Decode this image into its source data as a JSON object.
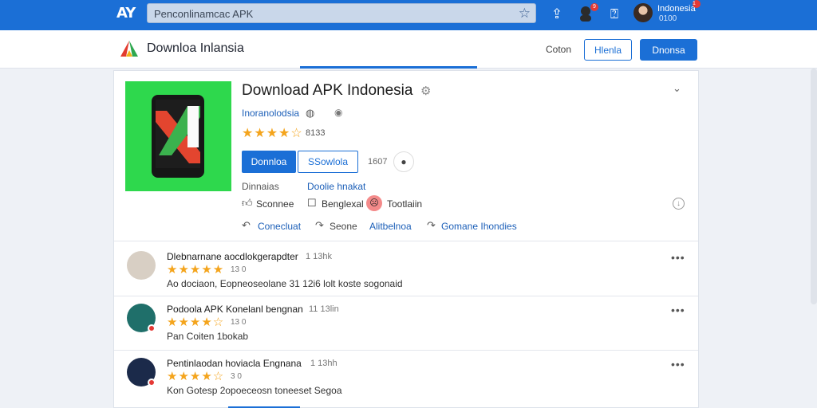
{
  "topbar": {
    "logo": "AY",
    "search_value": "Penconlinamcac APK",
    "notif_count": "9",
    "user_name": "Indonesia",
    "user_sub": "0100",
    "user_badge": "1"
  },
  "nav": {
    "brand": "Downloa Inlansia",
    "link": "Coton",
    "outline_btn": "Hlenla",
    "primary_btn": "Dnonsa"
  },
  "app": {
    "title": "Download APK Indonesia",
    "developer": "Inoranolodsia",
    "rating_stars": "★★★★☆",
    "rating_count": "8133",
    "primary_btn": "Donnloa",
    "secondary_btn": "SSowlola",
    "size": "1607",
    "meta_label": "Dinnaias",
    "meta_link": "Doolie hnakat",
    "items": [
      "Sconnee",
      "Benglexal",
      "Tootlaiin"
    ],
    "actions": [
      "Conecluat",
      "Seone",
      "Alitbelnoa",
      "Gomane Ihondies"
    ]
  },
  "reviews": [
    {
      "title": "Dlebnarnane aocdlokgerapdter",
      "time": "1 13hk",
      "stars": "★★★★★",
      "count": "13 0",
      "text": "Ao dociaon,  Eopneoseolane 31 12i6 lolt  koste sogonaid",
      "avatar_color": "#d8cfc4"
    },
    {
      "title": "Podoola APK Konelanl bengnan",
      "time": "11 13lin",
      "stars": "★★★★☆",
      "count": "13 0",
      "text": "Pan Coiten  1bokab",
      "avatar_color": "#1f6f6a"
    },
    {
      "title": "Pentinlaodan hoviacla Engnana",
      "time": "1 13hh",
      "stars": "★★★★☆",
      "count": "3 0",
      "text": "Kon Gotesp  2opoeceosn toneeset Segoa",
      "avatar_color": "#1b2a4a"
    }
  ],
  "colors": {
    "accent": "#1b6fd6",
    "star": "#f4a41c",
    "icon_bg": "#2ed84d"
  }
}
